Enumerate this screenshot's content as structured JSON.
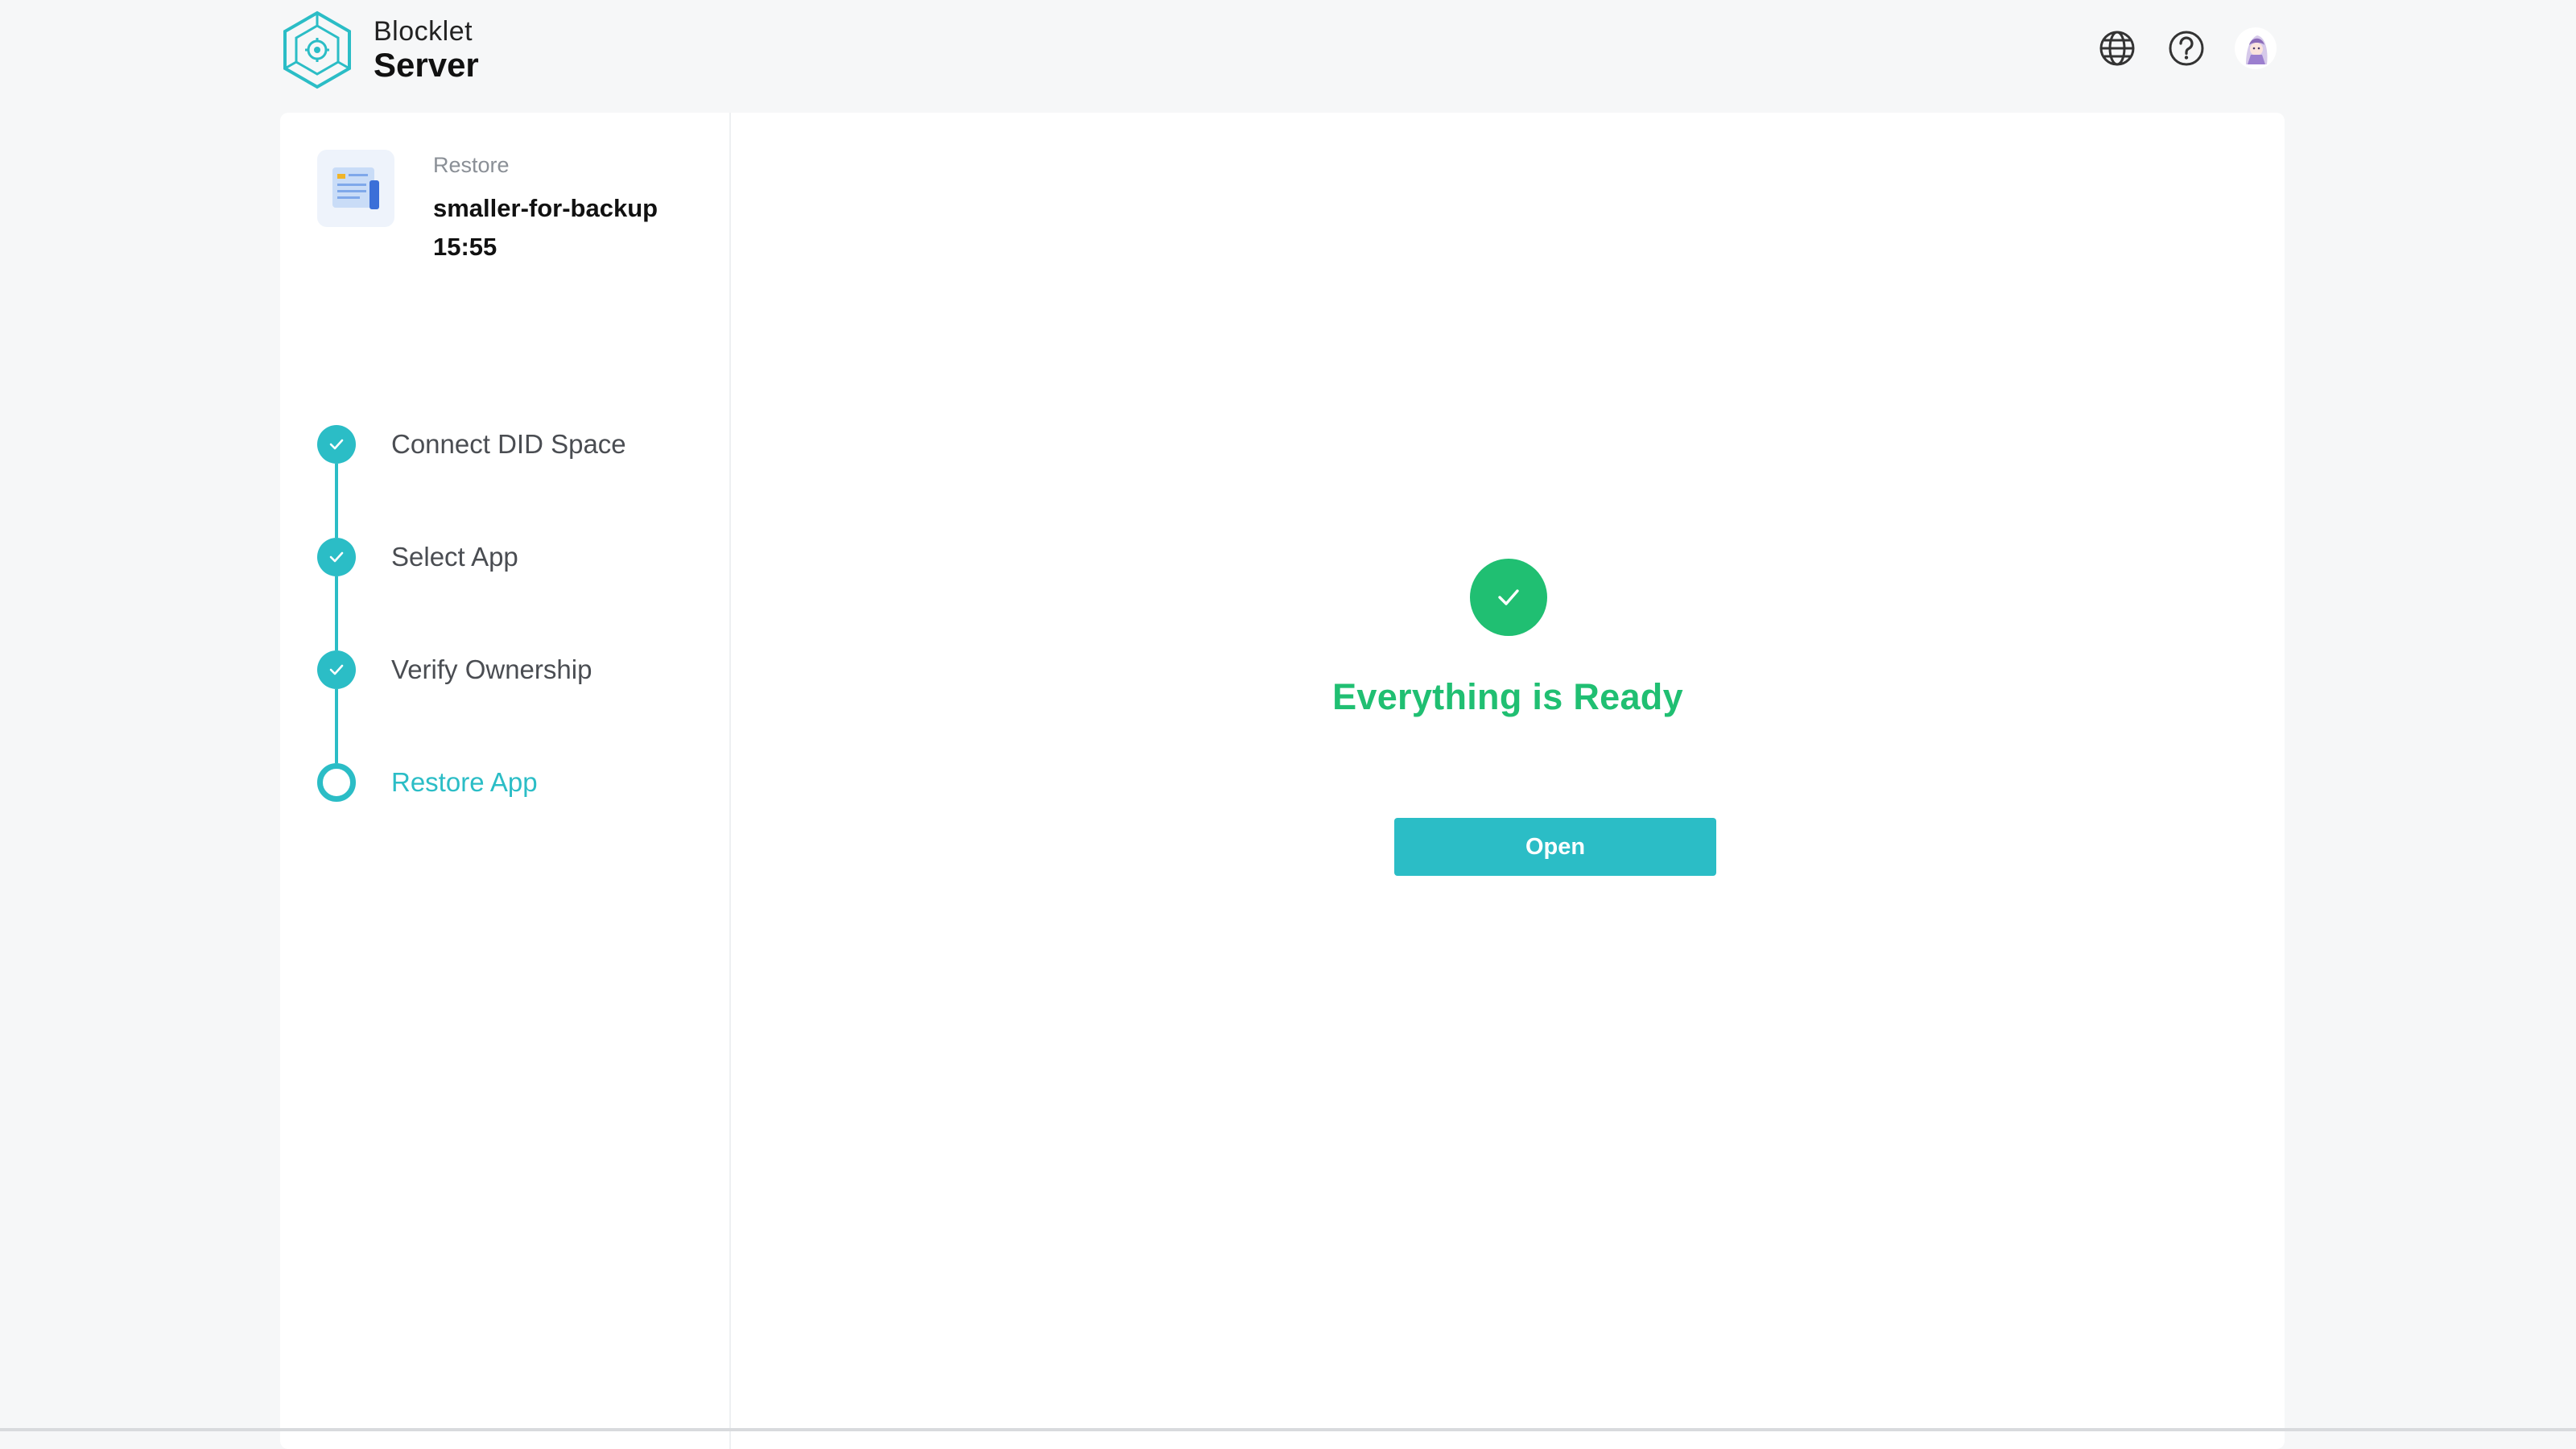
{
  "brand": {
    "name_top": "Blocklet",
    "name_bottom": "Server",
    "accent": "#2bbdc6"
  },
  "header": {
    "icons": [
      "globe-icon",
      "help-icon"
    ],
    "avatar": "user-avatar"
  },
  "backup": {
    "label": "Restore",
    "name_line1": "smaller-for-backup",
    "name_line2": "15:55"
  },
  "steps": [
    {
      "label": "Connect DID Space",
      "status": "done"
    },
    {
      "label": "Select App",
      "status": "done"
    },
    {
      "label": "Verify Ownership",
      "status": "done"
    },
    {
      "label": "Restore App",
      "status": "active"
    }
  ],
  "result": {
    "title": "Everything is Ready",
    "button_label": "Open",
    "success_color": "#20bf72"
  }
}
